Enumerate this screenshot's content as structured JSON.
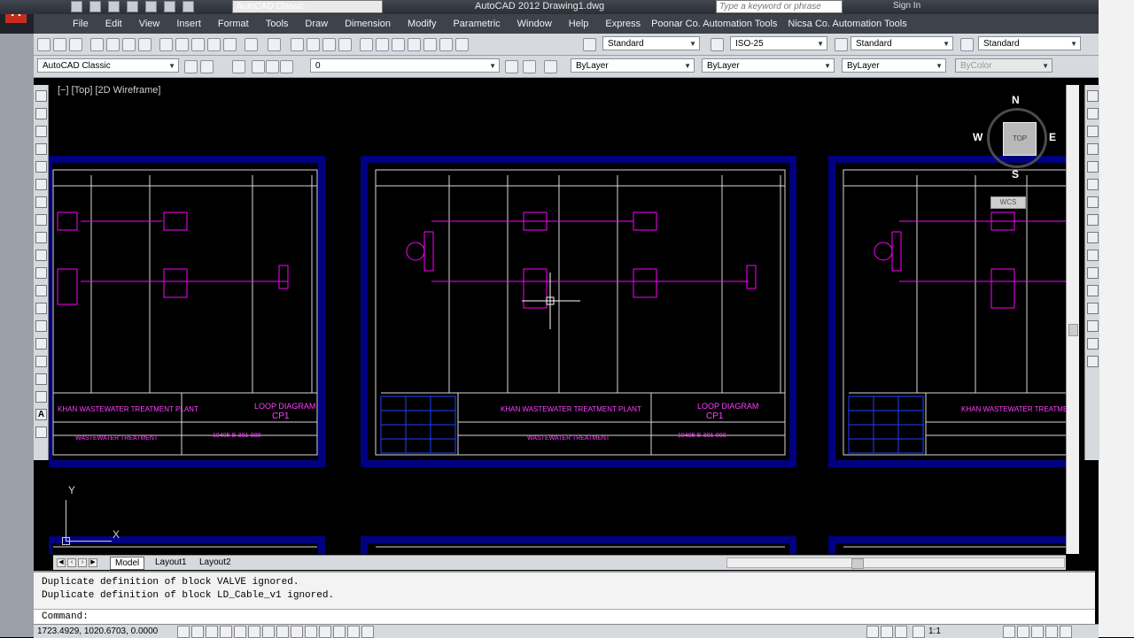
{
  "title_bar": {
    "app_title": "AutoCAD 2012   Drawing1.dwg",
    "workspace": "AutoCAD Classic",
    "search_placeholder": "Type a keyword or phrase",
    "sign_in": "Sign In"
  },
  "menu": [
    "File",
    "Edit",
    "View",
    "Insert",
    "Format",
    "Tools",
    "Draw",
    "Dimension",
    "Modify",
    "Parametric",
    "Window",
    "Help",
    "Express",
    "Poonar Co. Automation Tools",
    "Nicsa Co. Automation Tools"
  ],
  "styles_toolbar": {
    "text_style": "Standard",
    "dim_style": "ISO-25",
    "table_style": "Standard",
    "mleader_style": "Standard"
  },
  "workspace_toolbar": {
    "workspace": "AutoCAD Classic",
    "layer": "0",
    "color": "ByLayer",
    "linetype": "ByLayer",
    "lineweight": "ByLayer",
    "plotstyle": "ByColor"
  },
  "viewport_label": "[−] [Top] [2D Wireframe]",
  "viewcube": {
    "top_label": "TOP",
    "n": "N",
    "s": "S",
    "e": "E",
    "w": "W",
    "wcs": "WCS"
  },
  "ucs": {
    "x": "X",
    "y": "Y"
  },
  "sheets": {
    "header_title": "LOOP DIAGRAM",
    "header_id": "CP1",
    "plant_text": "KHAN WASTEWATER TREATMENT PLANT",
    "doc_no": "10405-E-301-000",
    "project": "WASTEWATER TREATMENT"
  },
  "tabs": [
    "Model",
    "Layout1",
    "Layout2"
  ],
  "command_lines": [
    "Duplicate definition of block VALVE  ignored.",
    "Duplicate definition of block LD_Cable_v1  ignored."
  ],
  "command_prompt": "Command:",
  "status": {
    "coords": "1723.4929, 1020.6703, 0.0000",
    "scale": "1:1"
  },
  "colors": {
    "drawing_line": "#e0e0e0",
    "magenta": "#ff00ff",
    "frame_blue": "#000080"
  }
}
